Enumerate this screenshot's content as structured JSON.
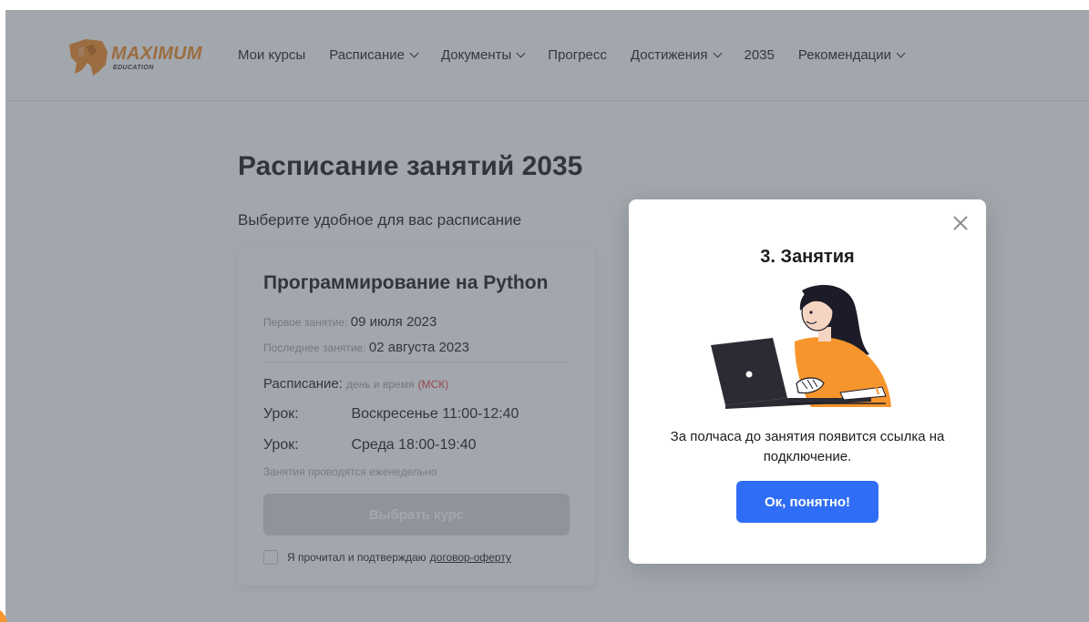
{
  "header": {
    "logo_text": "MAXIMUM",
    "logo_sub": "EDUCATION",
    "nav": [
      {
        "label": "Мои курсы",
        "dropdown": false
      },
      {
        "label": "Расписание",
        "dropdown": true
      },
      {
        "label": "Документы",
        "dropdown": true
      },
      {
        "label": "Прогресс",
        "dropdown": false
      },
      {
        "label": "Достижения",
        "dropdown": true
      },
      {
        "label": "2035",
        "dropdown": false
      },
      {
        "label": "Рекомендации",
        "dropdown": true
      }
    ]
  },
  "main": {
    "title": "Расписание занятий 2035",
    "subtitle": "Выберите удобное для вас расписание"
  },
  "card": {
    "title": "Программирование на Python",
    "first_label": "Первое занятие:",
    "first_date": "09 июля 2023",
    "last_label": "Последнее занятие:",
    "last_date": "02 августа 2023",
    "schedule_label": "Расписание:",
    "schedule_hint": "день и время",
    "schedule_tz": "(МСК)",
    "lessons": [
      {
        "label": "Урок:",
        "time": "Воскресенье 11:00-12:40"
      },
      {
        "label": "Урок:",
        "time": "Среда 18:00-19:40"
      }
    ],
    "weekly_note": "Занятия проводятся еженедельно",
    "choose_button": "Выбрать курс",
    "agree_text": "Я прочитал и подтверждаю",
    "agree_link": "договор-оферту"
  },
  "modal": {
    "title": "3. Занятия",
    "text": "За полчаса до занятия появится ссылка на подключение.",
    "ok_button": "Ок, понятно!"
  },
  "colors": {
    "accent_blue": "#2f6df6",
    "brand_orange": "#f08a24",
    "overlay": "rgba(70,80,92,0.5)",
    "tz_red": "#e23b3b"
  }
}
